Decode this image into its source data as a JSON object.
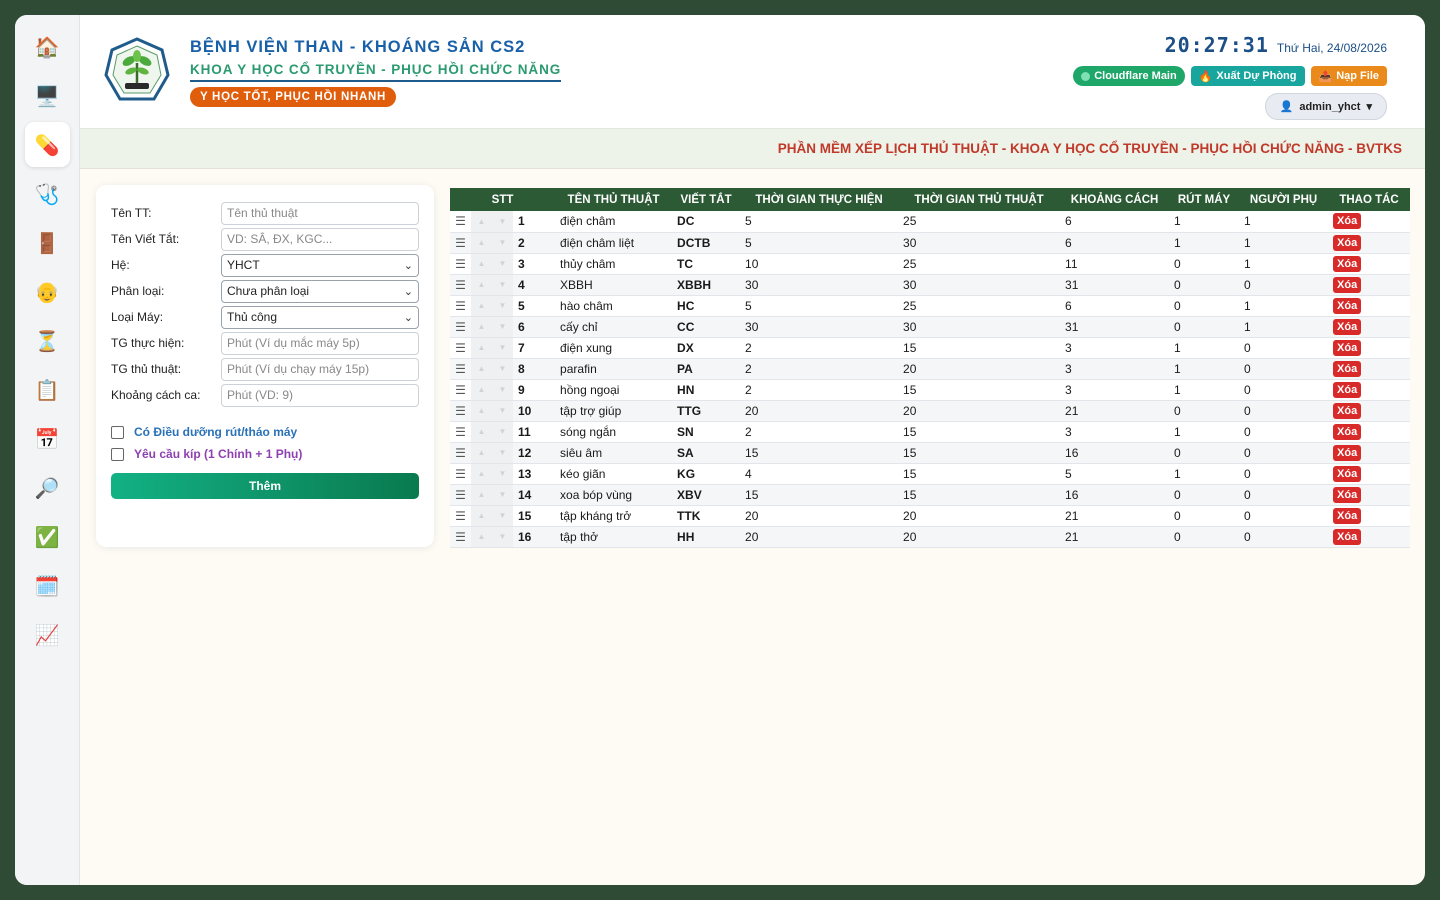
{
  "sidebar": {
    "items": [
      {
        "name": "home",
        "icon": "🏠"
      },
      {
        "name": "computer",
        "icon": "🖥️"
      },
      {
        "name": "procedures",
        "icon": "💊",
        "active": true
      },
      {
        "name": "stethoscope",
        "icon": "🩺"
      },
      {
        "name": "door",
        "icon": "🚪"
      },
      {
        "name": "patient",
        "icon": "👴"
      },
      {
        "name": "hourglass",
        "icon": "⏳"
      },
      {
        "name": "clipboard",
        "icon": "📋"
      },
      {
        "name": "calendar",
        "icon": "📅"
      },
      {
        "name": "search",
        "icon": "🔎"
      },
      {
        "name": "checkmark",
        "icon": "✅"
      },
      {
        "name": "calendar-grid",
        "icon": "🗓️"
      },
      {
        "name": "chart",
        "icon": "📈"
      }
    ]
  },
  "header": {
    "hospital": "BỆNH VIỆN THAN - KHOÁNG SẢN CS2",
    "department": "KHOA Y HỌC CỔ TRUYỀN - PHỤC HỒI CHỨC NĂNG",
    "motto": "Y HỌC TỐT, PHỤC HỒI NHANH",
    "clock": "20:27:31",
    "date": "Thứ Hai, 24/08/2026",
    "btn_cloudflare": "Cloudflare Main",
    "btn_export": "Xuất Dự Phòng",
    "btn_import": "Nạp File",
    "user": "admin_yhct",
    "accent_green": "#1fa76a",
    "accent_teal": "#17a59e",
    "accent_orange": "#ea8a1a"
  },
  "subtitle": "PHẦN MỀM XẾP LỊCH THỦ THUẬT - KHOA Y HỌC CỔ TRUYỀN - PHỤC HỒI CHỨC NĂNG - BVTKS",
  "form": {
    "name_label": "Tên TT:",
    "name_placeholder": "Tên thủ thuật",
    "abbr_label": "Tên Viết Tắt:",
    "abbr_placeholder": "VD: SÂ, ĐX, KGC...",
    "system_label": "Hệ:",
    "system_value": "YHCT",
    "category_label": "Phân loại:",
    "category_value": "Chưa phân loại",
    "machine_label": "Loại Máy:",
    "machine_value": "Thủ công",
    "exec_label": "TG thực hiện:",
    "exec_placeholder": "Phút (Ví dụ mắc máy 5p)",
    "proc_label": "TG thủ thuật:",
    "proc_placeholder": "Phút (Ví dụ chạy máy 15p)",
    "gap_label": "Khoảng cách ca:",
    "gap_placeholder": "Phút (VD: 9)",
    "check_nurse": "Có Điều dưỡng rút/tháo máy",
    "check_team": "Yêu cầu kíp (1 Chính + 1 Phụ)",
    "add_button": "Thêm"
  },
  "table": {
    "headers": [
      "STT",
      "TÊN THỦ THUẬT",
      "VIẾT TẮT",
      "THỜI GIAN THỰC HIỆN",
      "THỜI GIAN THỦ THUẬT",
      "KHOẢNG CÁCH",
      "RÚT MÁY",
      "NGƯỜI PHỤ",
      "THAO TÁC"
    ],
    "delete_label": "Xóa",
    "rows": [
      {
        "stt": "1",
        "name": "điện châm",
        "abbr": "DC",
        "exec": "5",
        "proc": "25",
        "gap": "6",
        "pull": "1",
        "assist": "1"
      },
      {
        "stt": "2",
        "name": "điện châm liệt",
        "abbr": "DCTB",
        "exec": "5",
        "proc": "30",
        "gap": "6",
        "pull": "1",
        "assist": "1"
      },
      {
        "stt": "3",
        "name": "thủy châm",
        "abbr": "TC",
        "exec": "10",
        "proc": "25",
        "gap": "11",
        "pull": "0",
        "assist": "1"
      },
      {
        "stt": "4",
        "name": "XBBH",
        "abbr": "XBBH",
        "exec": "30",
        "proc": "30",
        "gap": "31",
        "pull": "0",
        "assist": "0"
      },
      {
        "stt": "5",
        "name": "hào châm",
        "abbr": "HC",
        "exec": "5",
        "proc": "25",
        "gap": "6",
        "pull": "0",
        "assist": "1"
      },
      {
        "stt": "6",
        "name": "cấy chỉ",
        "abbr": "CC",
        "exec": "30",
        "proc": "30",
        "gap": "31",
        "pull": "0",
        "assist": "1"
      },
      {
        "stt": "7",
        "name": "điện xung",
        "abbr": "DX",
        "exec": "2",
        "proc": "15",
        "gap": "3",
        "pull": "1",
        "assist": "0"
      },
      {
        "stt": "8",
        "name": "parafin",
        "abbr": "PA",
        "exec": "2",
        "proc": "20",
        "gap": "3",
        "pull": "1",
        "assist": "0"
      },
      {
        "stt": "9",
        "name": "hồng ngoại",
        "abbr": "HN",
        "exec": "2",
        "proc": "15",
        "gap": "3",
        "pull": "1",
        "assist": "0"
      },
      {
        "stt": "10",
        "name": "tập trợ giúp",
        "abbr": "TTG",
        "exec": "20",
        "proc": "20",
        "gap": "21",
        "pull": "0",
        "assist": "0"
      },
      {
        "stt": "11",
        "name": "sóng ngắn",
        "abbr": "SN",
        "exec": "2",
        "proc": "15",
        "gap": "3",
        "pull": "1",
        "assist": "0"
      },
      {
        "stt": "12",
        "name": "siêu âm",
        "abbr": "SA",
        "exec": "15",
        "proc": "15",
        "gap": "16",
        "pull": "0",
        "assist": "0"
      },
      {
        "stt": "13",
        "name": "kéo giãn",
        "abbr": "KG",
        "exec": "4",
        "proc": "15",
        "gap": "5",
        "pull": "1",
        "assist": "0"
      },
      {
        "stt": "14",
        "name": "xoa bóp vùng",
        "abbr": "XBV",
        "exec": "15",
        "proc": "15",
        "gap": "16",
        "pull": "0",
        "assist": "0"
      },
      {
        "stt": "15",
        "name": "tập kháng trở",
        "abbr": "TTK",
        "exec": "20",
        "proc": "20",
        "gap": "21",
        "pull": "0",
        "assist": "0"
      },
      {
        "stt": "16",
        "name": "tập thở",
        "abbr": "HH",
        "exec": "20",
        "proc": "20",
        "gap": "21",
        "pull": "0",
        "assist": "0"
      }
    ]
  }
}
